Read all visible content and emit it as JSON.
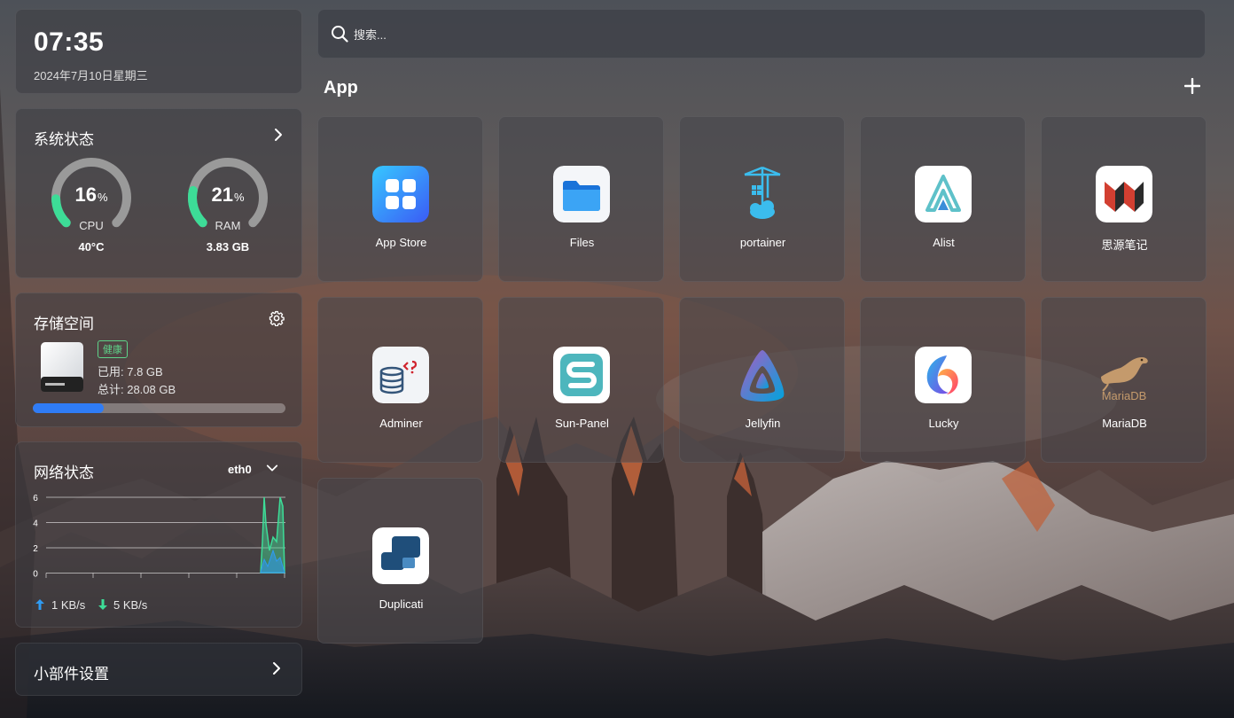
{
  "clock": {
    "time": "07:35",
    "date": "2024年7月10日星期三"
  },
  "system": {
    "title": "系统状态",
    "cpu": {
      "value": "16",
      "unit": "%",
      "label": "CPU",
      "sub": "40°C",
      "percent": 16
    },
    "ram": {
      "value": "21",
      "unit": "%",
      "label": "RAM",
      "sub": "3.83 GB",
      "percent": 21
    }
  },
  "storage": {
    "title": "存储空间",
    "badge": "健康",
    "used": "已用: 7.8 GB",
    "total": "总计: 28.08 GB",
    "percent": 28
  },
  "network": {
    "title": "网络状态",
    "interface": "eth0",
    "y_ticks": [
      "6",
      "4",
      "2",
      "0"
    ],
    "upload": "1 KB/s",
    "download": "5 KB/s"
  },
  "widget_settings": {
    "label": "小部件设置"
  },
  "search": {
    "placeholder": "搜索..."
  },
  "apps": {
    "section_title": "App",
    "items": [
      {
        "name": "App Store"
      },
      {
        "name": "Files"
      },
      {
        "name": "portainer"
      },
      {
        "name": "Alist"
      },
      {
        "name": "思源笔记"
      },
      {
        "name": "Adminer"
      },
      {
        "name": "Sun-Panel"
      },
      {
        "name": "Jellyfin"
      },
      {
        "name": "Lucky"
      },
      {
        "name": "MariaDB"
      },
      {
        "name": "Duplicati"
      }
    ]
  },
  "colors": {
    "gauge_active": "#3ddc97",
    "gauge_track": "#9a9a9a",
    "storage_bar": "#2f7cf6",
    "badge": "#5ed48a",
    "upload": "#2f9bf2",
    "download": "#3ddc97"
  },
  "icons": {
    "chevron": "chevron-right-icon",
    "settings": "gear-icon",
    "search": "search-icon",
    "add": "plus-icon"
  }
}
